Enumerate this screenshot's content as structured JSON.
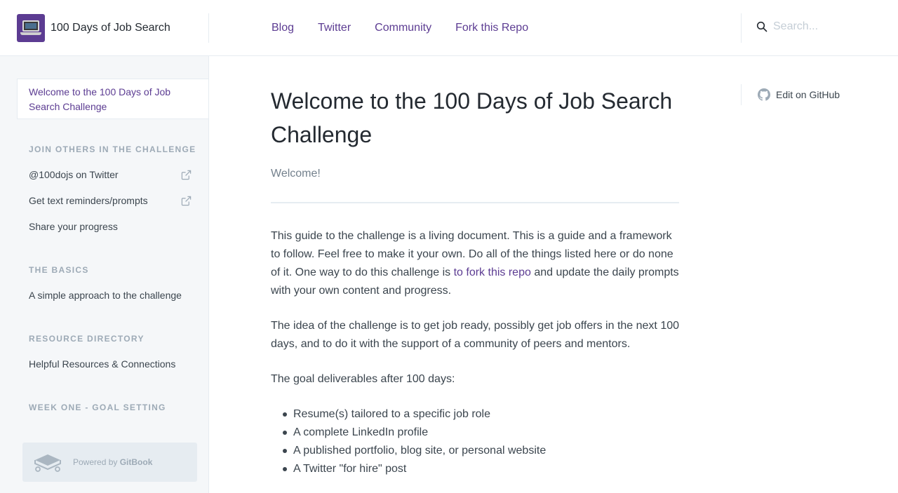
{
  "header": {
    "brand_title": "100 Days of Job Search",
    "logo_icon": "laptop-icon",
    "nav": [
      "Blog",
      "Twitter",
      "Community",
      "Fork this Repo"
    ],
    "search_placeholder": "Search..."
  },
  "sidebar": {
    "active_item": "Welcome to the 100 Days of Job Search Challenge",
    "sections": [
      {
        "title": "JOIN OTHERS IN THE CHALLENGE",
        "items": [
          {
            "label": "@100dojs on Twitter",
            "icon": "external-link-icon"
          },
          {
            "label": "Get text reminders/prompts",
            "icon": "external-link-icon"
          },
          {
            "label": "Share your progress"
          }
        ]
      },
      {
        "title": "THE BASICS",
        "items": [
          {
            "label": "A simple approach to the challenge"
          }
        ]
      },
      {
        "title": "RESOURCE DIRECTORY",
        "items": [
          {
            "label": "Helpful Resources & Connections"
          }
        ]
      },
      {
        "title": "WEEK ONE - GOAL SETTING",
        "items": []
      }
    ],
    "powered_prefix": "Powered by",
    "powered_brand": "GitBook"
  },
  "main": {
    "title": "Welcome to the 100 Days of Job Search Challenge",
    "subtitle": "Welcome!",
    "para1_before": "This guide to the challenge is a living document. This is a guide and a framework to follow. Feel free to make it your own. Do all of the things listed here or do none of it.  One way to do this challenge is ",
    "para1_link": "to fork this repo",
    "para1_after": " and update the daily prompts with your own content and progress.",
    "para2": "The idea of the challenge is to get job ready, possibly get job offers in the next 100 days, and to do it with the support of a community of peers and mentors.",
    "para3": "The goal deliverables after 100 days:",
    "bullets": [
      "Resume(s) tailored to a specific job role",
      "A complete LinkedIn profile",
      "A published portfolio, blog site, or personal website",
      "A Twitter \"for hire\" post"
    ]
  },
  "rail": {
    "edit_label": "Edit on GitHub",
    "edit_icon": "github-icon"
  },
  "colors": {
    "accent": "#5c3c92",
    "sidebar_bg": "#f5f7f9",
    "border": "#e6ecf1",
    "heading": "#242a31",
    "text": "#3b454e",
    "muted": "#9daab6"
  }
}
